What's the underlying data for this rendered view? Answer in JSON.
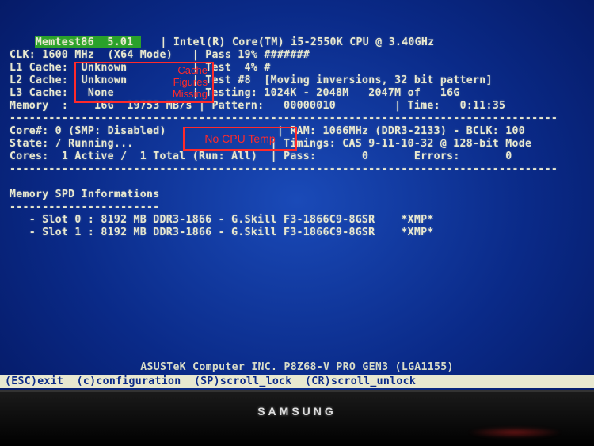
{
  "title": {
    "name": "Memtest86",
    "version": "5.01",
    "cpu": "Intel(R) Core(TM) i5-2550K CPU @ 3.40GHz"
  },
  "clk": {
    "speed": "1600 MHz",
    "mode": "(X64 Mode)"
  },
  "cache": {
    "l1": "Unknown",
    "l2": "Unknown",
    "l3": "None"
  },
  "memory": {
    "size": "16G",
    "bw": "19753 MB/s"
  },
  "pass": {
    "pct": "19%",
    "bar": "#######"
  },
  "test": {
    "pct": "4%",
    "bar": "#"
  },
  "testnum": {
    "id": "#8",
    "desc": "[Moving inversions, 32 bit pattern]"
  },
  "testing": {
    "range": "1024K - 2048M",
    "of": "2047M of",
    "total": "16G"
  },
  "pattern": {
    "value": "00000010",
    "time_label": "Time:",
    "time": "0:11:35"
  },
  "core": {
    "line": "Core#: 0 (SMP: Disabled)"
  },
  "state": {
    "line": "State: / Running..."
  },
  "cores": {
    "line": "Cores:  1 Active /  1 Total (Run: All)"
  },
  "ram": {
    "line": "RAM: 1066MHz (DDR3-2133) - BCLK: 100"
  },
  "timings": {
    "line": "Timings: CAS 9-11-10-32 @ 128-bit Mode"
  },
  "passerr": {
    "pass_label": "Pass:",
    "pass": "0",
    "err_label": "Errors:",
    "err": "0"
  },
  "spd": {
    "heading": "Memory SPD Informations",
    "slots": [
      "- Slot 0 : 8192 MB DDR3-1866 - G.Skill F3-1866C9-8GSR    *XMP*",
      "- Slot 1 : 8192 MB DDR3-1866 - G.Skill F3-1866C9-8GSR    *XMP*"
    ]
  },
  "mobo": "ASUSTeK Computer INC. P8Z68-V PRO GEN3 (LGA1155)",
  "footer": "(ESC)exit  (c)configuration  (SP)scroll_lock  (CR)scroll_unlock",
  "annotations": {
    "cache_l1": "Cache",
    "cache_l2": "Figures",
    "cache_l3": "Missing",
    "temp": "No CPU Temp"
  },
  "monitor": "SAMSUNG"
}
